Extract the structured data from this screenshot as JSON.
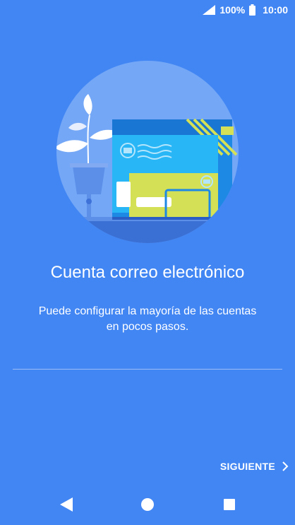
{
  "status_bar": {
    "battery_percent": "100%",
    "time": "10:00",
    "signal_icon": "signal-icon",
    "battery_icon": "battery-full-icon"
  },
  "illustration": {
    "icon": "email-envelope-illustration"
  },
  "main": {
    "title": "Cuenta correo electrónico",
    "subtitle_line1": "Puede configurar la mayoría de las cuentas",
    "subtitle_line2": "en pocos pasos."
  },
  "actions": {
    "next_label": "SIGUIENTE",
    "next_icon": "chevron-right-icon"
  },
  "nav_bar": {
    "back_icon": "back-icon",
    "home_icon": "home-icon",
    "recent_icon": "recent-apps-icon"
  },
  "colors": {
    "background": "#4286f4",
    "illustration_circle": "#74a8f7",
    "envelope_blue": "#29b6f6",
    "envelope_yellow": "#d4e157"
  }
}
